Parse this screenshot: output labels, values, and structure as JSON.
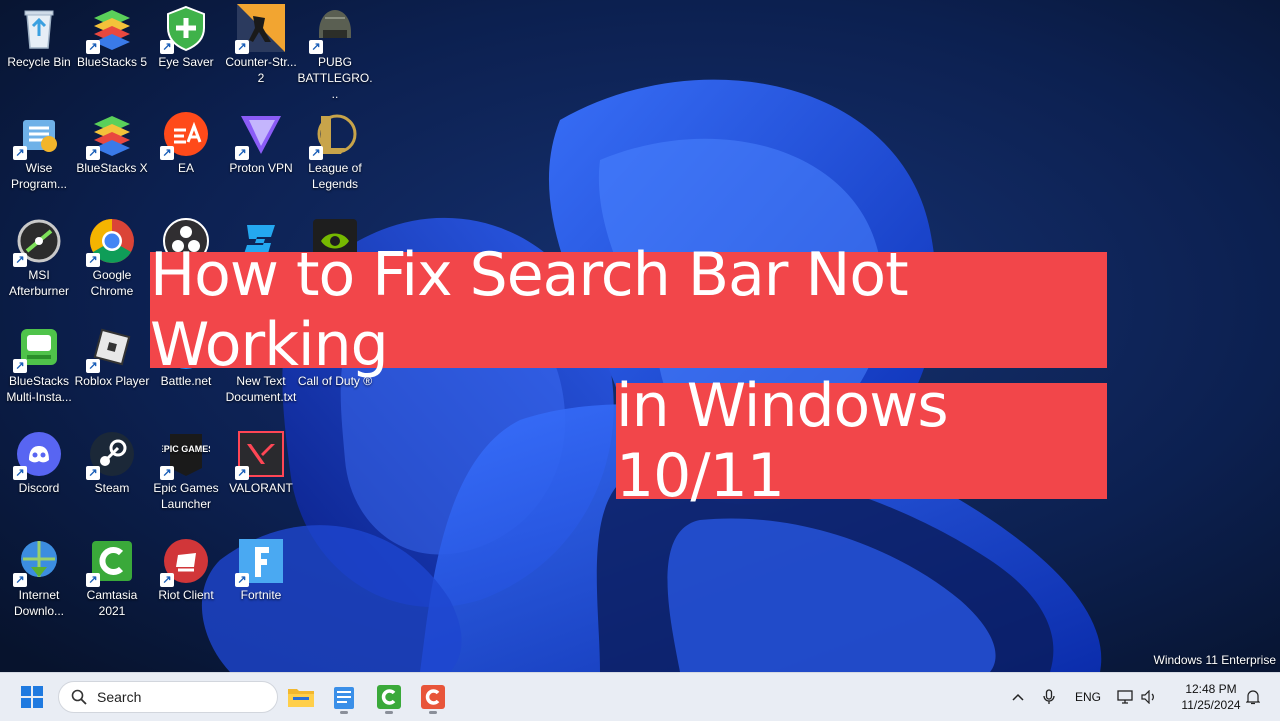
{
  "desktop": {
    "icons": [
      {
        "label": "Recycle Bin"
      },
      {
        "label": "BlueStacks 5"
      },
      {
        "label": "Eye Saver"
      },
      {
        "label": "Counter-Str... 2"
      },
      {
        "label": "PUBG BATTLEGRO..."
      },
      {
        "label": "Wise Program..."
      },
      {
        "label": "BlueStacks X"
      },
      {
        "label": "EA"
      },
      {
        "label": "Proton VPN"
      },
      {
        "label": "League of Legends"
      },
      {
        "label": "MSI Afterburner"
      },
      {
        "label": "Google Chrome"
      },
      {
        "label": "BlueStacks Multi-Insta..."
      },
      {
        "label": "Roblox Player"
      },
      {
        "label": "Battle.net"
      },
      {
        "label": "New Text Document.txt"
      },
      {
        "label": "Call of Duty ®"
      },
      {
        "label": "Discord"
      },
      {
        "label": "Steam"
      },
      {
        "label": "Epic Games Launcher"
      },
      {
        "label": "VALORANT"
      },
      {
        "label": "Internet Downlo..."
      },
      {
        "label": "Camtasia 2021"
      },
      {
        "label": "Riot Client"
      },
      {
        "label": "Fortnite"
      }
    ],
    "edition_text": "Windows 11 Enterprise",
    "epic_logo_text": "EPIC GAMES"
  },
  "overlay": {
    "line1": "How to Fix Search Bar Not Working",
    "line2": "in Windows 10/11"
  },
  "taskbar": {
    "search_placeholder": "Search",
    "language": "ENG",
    "time": "12:48 PM",
    "date": "11/25/2024"
  },
  "colors": {
    "banner": "#f2464a",
    "wallpaper_bg": "#0b1a3c",
    "bloom": "#1f4fe0",
    "taskbar": "#e9edf4"
  }
}
